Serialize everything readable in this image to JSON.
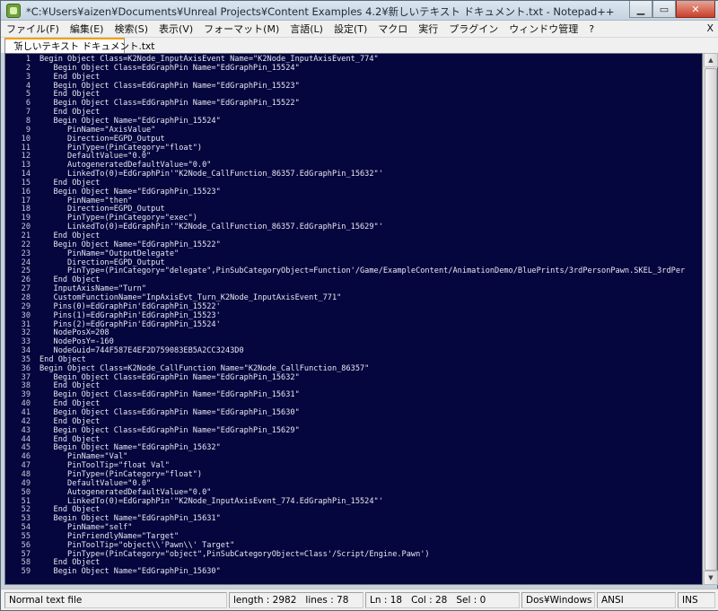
{
  "window": {
    "title": "*C:¥Users¥aizen¥Documents¥Unreal Projects¥Content Examples 4.2¥新しいテキスト ドキュメント.txt - Notepad++",
    "minimize_label": "▁",
    "maximize_label": "▭",
    "close_label": "✕"
  },
  "menu": {
    "items": [
      "ファイル(F)",
      "編集(E)",
      "検索(S)",
      "表示(V)",
      "フォーマット(M)",
      "言語(L)",
      "設定(T)",
      "マクロ",
      "実行",
      "プラグイン",
      "ウィンドウ管理",
      "?"
    ],
    "close_label": "X"
  },
  "tab": {
    "label": "新しいテキスト ドキュメント.txt"
  },
  "editor": {
    "lines": [
      {
        "n": "1",
        "text": "Begin Object Class=K2Node_InputAxisEvent Name=\"K2Node_InputAxisEvent_774\""
      },
      {
        "n": "2",
        "text": "   Begin Object Class=EdGraphPin Name=\"EdGraphPin_15524\""
      },
      {
        "n": "3",
        "text": "   End Object"
      },
      {
        "n": "4",
        "text": "   Begin Object Class=EdGraphPin Name=\"EdGraphPin_15523\""
      },
      {
        "n": "5",
        "text": "   End Object"
      },
      {
        "n": "6",
        "text": "   Begin Object Class=EdGraphPin Name=\"EdGraphPin_15522\""
      },
      {
        "n": "7",
        "text": "   End Object"
      },
      {
        "n": "8",
        "text": "   Begin Object Name=\"EdGraphPin_15524\""
      },
      {
        "n": "9",
        "text": "      PinName=\"AxisValue\""
      },
      {
        "n": "10",
        "text": "      Direction=EGPD_Output"
      },
      {
        "n": "11",
        "text": "      PinType=(PinCategory=\"float\")"
      },
      {
        "n": "12",
        "text": "      DefaultValue=\"0.0\""
      },
      {
        "n": "13",
        "text": "      AutogeneratedDefaultValue=\"0.0\""
      },
      {
        "n": "14",
        "text": "      LinkedTo(0)=EdGraphPin'\"K2Node_CallFunction_86357.EdGraphPin_15632\"'"
      },
      {
        "n": "15",
        "text": "   End Object"
      },
      {
        "n": "16",
        "text": "   Begin Object Name=\"EdGraphPin_15523\""
      },
      {
        "n": "17",
        "text": "      PinName=\"then\""
      },
      {
        "n": "18",
        "text": "      Direction=EGPD_Output"
      },
      {
        "n": "19",
        "text": "      PinType=(PinCategory=\"exec\")"
      },
      {
        "n": "20",
        "text": "      LinkedTo(0)=EdGraphPin'\"K2Node_CallFunction_86357.EdGraphPin_15629\"'"
      },
      {
        "n": "21",
        "text": "   End Object"
      },
      {
        "n": "22",
        "text": "   Begin Object Name=\"EdGraphPin_15522\""
      },
      {
        "n": "23",
        "text": "      PinName=\"OutputDelegate\""
      },
      {
        "n": "24",
        "text": "      Direction=EGPD_Output"
      },
      {
        "n": "25",
        "text": "      PinType=(PinCategory=\"delegate\",PinSubCategoryObject=Function'/Game/ExampleContent/AnimationDemo/BluePrints/3rdPersonPawn.SKEL_3rdPer"
      },
      {
        "n": "26",
        "text": "   End Object"
      },
      {
        "n": "27",
        "text": "   InputAxisName=\"Turn\""
      },
      {
        "n": "28",
        "text": "   CustomFunctionName=\"InpAxisEvt_Turn_K2Node_InputAxisEvent_771\""
      },
      {
        "n": "29",
        "text": "   Pins(0)=EdGraphPin'EdGraphPin_15522'"
      },
      {
        "n": "30",
        "text": "   Pins(1)=EdGraphPin'EdGraphPin_15523'"
      },
      {
        "n": "31",
        "text": "   Pins(2)=EdGraphPin'EdGraphPin_15524'"
      },
      {
        "n": "32",
        "text": "   NodePosX=208"
      },
      {
        "n": "33",
        "text": "   NodePosY=-160"
      },
      {
        "n": "34",
        "text": "   NodeGuid=744F587E4EF2D759083EB5A2CC3243D0"
      },
      {
        "n": "35",
        "text": "End Object"
      },
      {
        "n": "36",
        "text": "Begin Object Class=K2Node_CallFunction Name=\"K2Node_CallFunction_86357\""
      },
      {
        "n": "37",
        "text": "   Begin Object Class=EdGraphPin Name=\"EdGraphPin_15632\""
      },
      {
        "n": "38",
        "text": "   End Object"
      },
      {
        "n": "39",
        "text": "   Begin Object Class=EdGraphPin Name=\"EdGraphPin_15631\""
      },
      {
        "n": "40",
        "text": "   End Object"
      },
      {
        "n": "41",
        "text": "   Begin Object Class=EdGraphPin Name=\"EdGraphPin_15630\""
      },
      {
        "n": "42",
        "text": "   End Object"
      },
      {
        "n": "43",
        "text": "   Begin Object Class=EdGraphPin Name=\"EdGraphPin_15629\""
      },
      {
        "n": "44",
        "text": "   End Object"
      },
      {
        "n": "45",
        "text": "   Begin Object Name=\"EdGraphPin_15632\""
      },
      {
        "n": "46",
        "text": "      PinName=\"Val\""
      },
      {
        "n": "47",
        "text": "      PinToolTip=\"float Val\""
      },
      {
        "n": "48",
        "text": "      PinType=(PinCategory=\"float\")"
      },
      {
        "n": "49",
        "text": "      DefaultValue=\"0.0\""
      },
      {
        "n": "50",
        "text": "      AutogeneratedDefaultValue=\"0.0\""
      },
      {
        "n": "51",
        "text": "      LinkedTo(0)=EdGraphPin'\"K2Node_InputAxisEvent_774.EdGraphPin_15524\"'"
      },
      {
        "n": "52",
        "text": "   End Object"
      },
      {
        "n": "53",
        "text": "   Begin Object Name=\"EdGraphPin_15631\""
      },
      {
        "n": "54",
        "text": "      PinName=\"self\""
      },
      {
        "n": "55",
        "text": "      PinFriendlyName=\"Target\""
      },
      {
        "n": "56",
        "text": "      PinToolTip=\"object\\\\'Pawn\\\\' Target\""
      },
      {
        "n": "57",
        "text": "      PinType=(PinCategory=\"object\",PinSubCategoryObject=Class'/Script/Engine.Pawn')"
      },
      {
        "n": "58",
        "text": "   End Object"
      },
      {
        "n": "59",
        "text": "   Begin Object Name=\"EdGraphPin_15630\""
      }
    ]
  },
  "status": {
    "file_type": "Normal text file",
    "length": "length : 2982",
    "lines": "lines : 78",
    "ln": "Ln : 18",
    "col": "Col : 28",
    "sel": "Sel : 0",
    "eol": "Dos¥Windows",
    "encoding": "ANSI",
    "mode": "INS"
  }
}
